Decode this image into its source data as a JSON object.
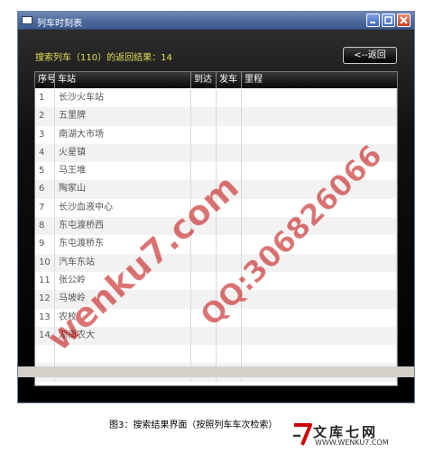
{
  "window": {
    "title": "列车时刻表"
  },
  "search": {
    "result_text": "搜索列车（110）的返回结果：14",
    "back_label": "<--返回"
  },
  "table": {
    "headers": [
      "序号",
      "车站",
      "到达",
      "发车",
      "里程"
    ],
    "rows": [
      [
        "1",
        "长沙火车站",
        "",
        "",
        ""
      ],
      [
        "2",
        "五里牌",
        "",
        "",
        ""
      ],
      [
        "3",
        "南湖大市场",
        "",
        "",
        ""
      ],
      [
        "4",
        "火星镇",
        "",
        "",
        ""
      ],
      [
        "5",
        "马王堆",
        "",
        "",
        ""
      ],
      [
        "6",
        "陶家山",
        "",
        "",
        ""
      ],
      [
        "7",
        "长沙血液中心",
        "",
        "",
        ""
      ],
      [
        "8",
        "东屯渡桥西",
        "",
        "",
        ""
      ],
      [
        "9",
        "东屯渡桥东",
        "",
        "",
        ""
      ],
      [
        "10",
        "汽车东站",
        "",
        "",
        ""
      ],
      [
        "11",
        "张公岭",
        "",
        "",
        ""
      ],
      [
        "12",
        "马坡岭",
        "",
        "",
        ""
      ],
      [
        "13",
        "农校",
        "",
        "",
        ""
      ],
      [
        "14",
        "湖南农大",
        "",
        "",
        ""
      ],
      [
        "",
        "",
        "",
        "",
        ""
      ],
      [
        "",
        "",
        "",
        "",
        ""
      ]
    ]
  },
  "caption": "图3：搜索结果界面（按照列车车次检索）",
  "watermarks": [
    "wenku7.com",
    "QQ:306826066"
  ],
  "logo": {
    "mark": "7",
    "name": "文库七网",
    "url": "WWW.WENKU7.COM"
  },
  "colors": {
    "result_text": "#e2df56",
    "titlebar": "#4d6a9e",
    "watermark": "#be0000"
  }
}
